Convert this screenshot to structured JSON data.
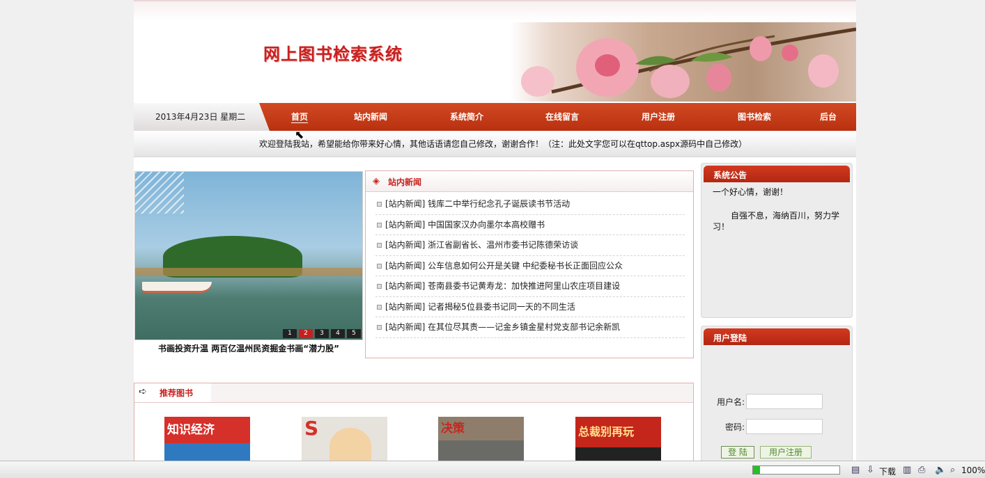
{
  "header": {
    "title": "网上图书检索系统"
  },
  "nav": {
    "date": "2013年4月23日 星期二",
    "items": [
      "首页",
      "站内新闻",
      "系统简介",
      "在线留言",
      "用户注册",
      "图书检索",
      "后台"
    ]
  },
  "notice_bar": "欢迎登陆我站，希望能给你带来好心情，其他话语请您自己修改，谢谢合作！（注：此处文字您可以在qttop.aspx源码中自己修改）",
  "slider": {
    "pages": [
      "1",
      "2",
      "3",
      "4",
      "5"
    ],
    "active_page": "2",
    "caption": "书画投资升温 两百亿温州民资掘金书画“潜力股”"
  },
  "news": {
    "title": "站内新闻",
    "items": [
      "[站内新闻] 钱库二中举行纪念孔子诞辰读书节活动",
      "[站内新闻] 中国国家汉办向墨尔本高校赠书",
      "[站内新闻] 浙江省副省长、温州市委书记陈德荣访谈",
      "[站内新闻] 公车信息如何公开是关键 中纪委秘书长正面回应公众",
      "[站内新闻] 苍南县委书记黄寿龙：加快推进阿里山农庄项目建设",
      "[站内新闻] 记者揭秘5位县委书记同一天的不同生活",
      "[站内新闻] 在其位尽其责——记金乡镇金星村党支部书记余新凯"
    ]
  },
  "recommend": {
    "title": "推荐图书",
    "books": [
      {
        "cover_text": "知识经济",
        "color": "#d6302a"
      },
      {
        "cover_text": "S",
        "color": "#e6e2dc"
      },
      {
        "cover_text": "决策",
        "color": "#8f7d6b"
      },
      {
        "cover_text": "总裁别再玩",
        "color": "#c4261c"
      }
    ]
  },
  "announcement": {
    "title": "系统公告",
    "line1": "一个好心情，谢谢！",
    "line2": "自强不息，海纳百川，努力学习！"
  },
  "login": {
    "title": "用户登陆",
    "username_label": "用户名:",
    "password_label": "密码:",
    "login_button": "登 陆",
    "register_button": "用户注册"
  },
  "statusbar": {
    "download_label": "下载",
    "zoom": "100%",
    "progress": 0.08
  },
  "colors": {
    "accent": "#c8201f",
    "nav": "#c63d1a"
  }
}
